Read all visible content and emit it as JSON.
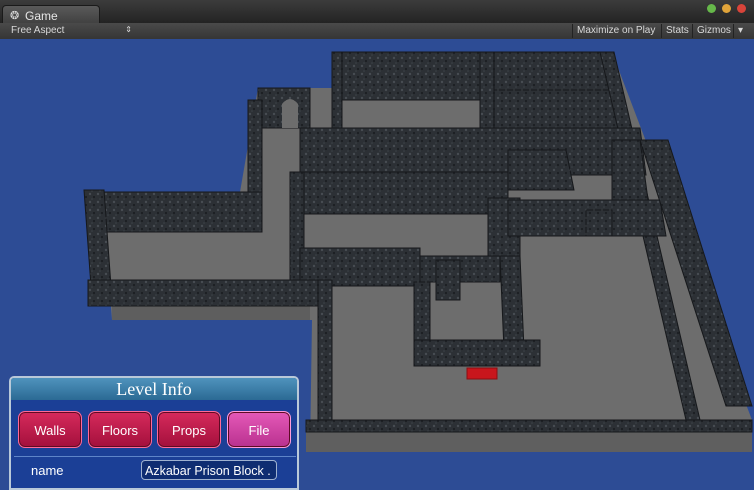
{
  "window": {
    "tab_icon": "unity-game-icon",
    "tab_title": "Game",
    "buttons": [
      "#66b84a",
      "#e0a43a",
      "#d9443a"
    ]
  },
  "toolbar": {
    "aspect_label": "Free Aspect",
    "aspect_arrow": "⇕",
    "maximize_label": "Maximize on Play",
    "stats_label": "Stats",
    "gizmos_label": "Gizmos",
    "gizmos_arrow": "▾"
  },
  "panel": {
    "title": "Level Info",
    "buttons": {
      "walls": "Walls",
      "floors": "Floors",
      "props": "Props",
      "file": "File"
    },
    "active_button": "file",
    "name_label": "name",
    "name_value": "Azkabar Prison Block ."
  },
  "colors": {
    "background": "#2d4c95",
    "floor": "#6d6d6d",
    "wall": "#2c3035",
    "marker": "#c8161c"
  }
}
